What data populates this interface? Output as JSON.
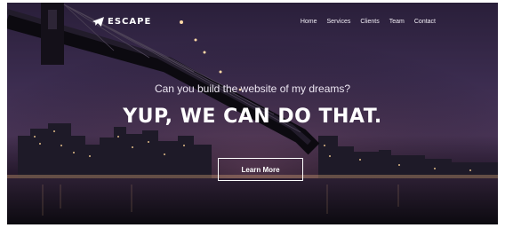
{
  "nav": {
    "brand": "ESCAPE",
    "items": [
      {
        "label": "Home"
      },
      {
        "label": "Services"
      },
      {
        "label": "Clients"
      },
      {
        "label": "Team"
      },
      {
        "label": "Contact"
      }
    ]
  },
  "hero": {
    "tagline": "Can you build the website of my dreams?",
    "headline": "YUP, WE CAN DO THAT.",
    "cta_label": "Learn More"
  },
  "colors": {
    "overlay": "#3b2c4f",
    "text": "#ffffff"
  },
  "icons": {
    "brand_icon": "paper-plane-icon"
  }
}
